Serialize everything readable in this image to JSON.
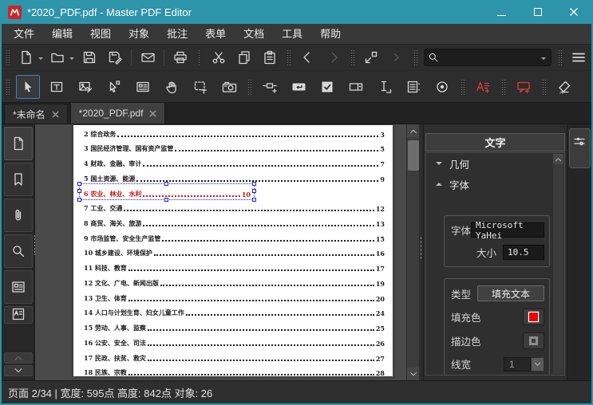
{
  "window": {
    "title": "*2020_PDF.pdf - Master PDF Editor",
    "controls": [
      "minimize",
      "maximize",
      "close"
    ]
  },
  "menu": {
    "items": [
      "文件",
      "编辑",
      "视图",
      "对象",
      "批注",
      "表单",
      "文档",
      "工具",
      "帮助"
    ]
  },
  "toolbars": {
    "row1_icons": [
      "new-document",
      "open-document",
      "save",
      "save-as",
      "email",
      "print",
      "cut",
      "copy",
      "paste",
      "back",
      "forward",
      "fit-page",
      "search",
      "main-menu"
    ],
    "row2_icons": [
      "select-tool",
      "edit-text-tool",
      "edit-image-tool",
      "edit-path-tool",
      "edit-forms-tool",
      "hand-tool",
      "select-area-tool",
      "screenshot-tool",
      "link-field",
      "button-field",
      "checkbox-field",
      "combobox-field",
      "text-field",
      "listbox-field",
      "radiobutton-field",
      "highlight-text",
      "sticky-note",
      "eraser"
    ],
    "active_tool": "select-tool",
    "search": {
      "value": "",
      "placeholder": ""
    }
  },
  "tabs": {
    "items": [
      {
        "label": "*未命名",
        "active": false
      },
      {
        "label": "*2020_PDF.pdf",
        "active": true
      }
    ]
  },
  "sidebar": {
    "icons": [
      "page-thumbnails",
      "bookmarks",
      "attachments",
      "search",
      "form-fields",
      "signature",
      "scroll-up",
      "scroll-down"
    ]
  },
  "document": {
    "toc": [
      {
        "label": "2 综合政务",
        "page": "3",
        "selected": false
      },
      {
        "label": "3 国民经济管理、国有资产监管",
        "page": "5",
        "selected": false
      },
      {
        "label": "4 财政、金融、审计",
        "page": "7",
        "selected": false
      },
      {
        "label": "5 国土资源、能源",
        "page": "9",
        "selected": false
      },
      {
        "label": "6 农业、林业、水利",
        "page": "10",
        "selected": true
      },
      {
        "label": "7 工业、交通",
        "page": "12",
        "selected": false
      },
      {
        "label": "8 商贸、海关、旅游",
        "page": "13",
        "selected": false
      },
      {
        "label": "9 市场监管、安全生产监管",
        "page": "15",
        "selected": false
      },
      {
        "label": "10 城乡建设、环境保护",
        "page": "16",
        "selected": false
      },
      {
        "label": "11 科技、教育",
        "page": "17",
        "selected": false
      },
      {
        "label": "12 文化、广电、新闻出版",
        "page": "19",
        "selected": false
      },
      {
        "label": "13 卫生、体育",
        "page": "20",
        "selected": false
      },
      {
        "label": "14 人口与计划生育、妇女儿童工作",
        "page": "24",
        "selected": false
      },
      {
        "label": "15 劳动、人事、监察",
        "page": "25",
        "selected": false
      },
      {
        "label": "16 公安、安全、司法",
        "page": "26",
        "selected": false
      },
      {
        "label": "17 民政、扶贫、救灾",
        "page": "27",
        "selected": false
      },
      {
        "label": "18 民族、宗教",
        "page": "28",
        "selected": false
      }
    ]
  },
  "panel": {
    "title": "文字",
    "section_geometry": "几何",
    "section_font": "字体",
    "font_label": "字体",
    "font_value": "Microsoft YaHei",
    "size_label": "大小",
    "size_value": "10.5",
    "type_label": "类型",
    "type_value": "填充文本",
    "fill_label": "填充色",
    "fill_color": "#ee0000",
    "stroke_label": "描边色",
    "linewidth_label": "线宽",
    "linewidth_value": "1"
  },
  "statusbar": {
    "text": "页面 2/34 | 宽度: 595点 高度: 842点 对象: 26"
  },
  "colors": {
    "titlebar": "#2e94a9",
    "toolbar_bg": "#2d2d2d",
    "doc_bg": "#4a4a4a",
    "selection_blue": "#2020cc",
    "accent_red": "#ee0000"
  }
}
